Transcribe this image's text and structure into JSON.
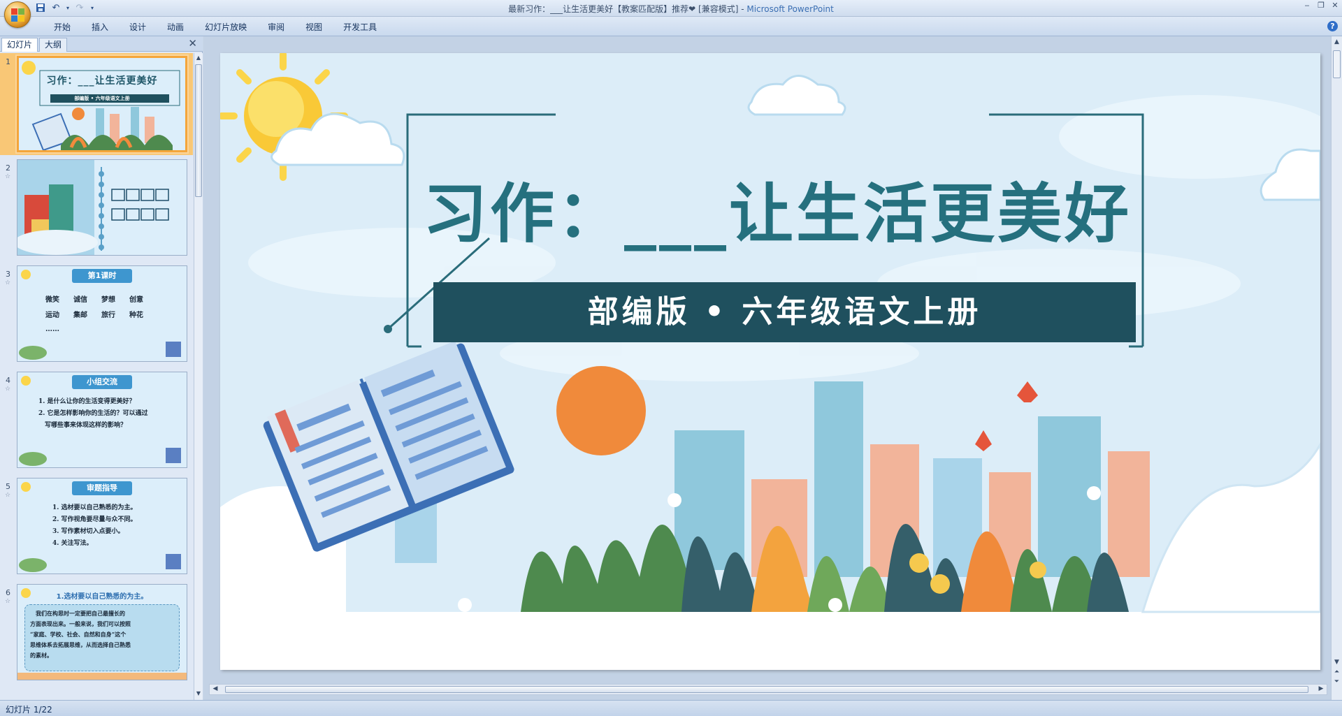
{
  "window": {
    "title_doc": "最新习作：___让生活更美好【教案匹配版】推荐❤ [兼容模式] - ",
    "title_app": "Microsoft PowerPoint"
  },
  "ribbon": {
    "tabs": [
      "开始",
      "插入",
      "设计",
      "动画",
      "幻灯片放映",
      "审阅",
      "视图",
      "开发工具"
    ]
  },
  "panel": {
    "tab_slides": "幻灯片",
    "tab_outline": "大纲",
    "thumbnails": [
      {
        "num": "1",
        "title": "习作：___让生活更美好",
        "subtitle": "部编版 • 六年级语文上册"
      },
      {
        "num": "2",
        "title": "",
        "subtitle": ""
      },
      {
        "num": "3",
        "badge": "第1课时",
        "lines": [
          "微笑　　诚信　　梦想　　创意",
          "运动　　集邮　　旅行　　种花",
          "……"
        ]
      },
      {
        "num": "4",
        "badge": "小组交流",
        "lines": [
          "1. 是什么让你的生活变得更美好？",
          "2. 它是怎样影响你的生活的？可以通过",
          "　写哪些事来体现这样的影响？"
        ]
      },
      {
        "num": "5",
        "badge": "审题指导",
        "lines": [
          "1. 选材要以自己熟悉的为主。",
          "2. 写作视角要尽量与众不同。",
          "3. 写作素材切入点要小。",
          "4. 关注写法。"
        ]
      },
      {
        "num": "6",
        "title": "1.选材要以自己熟悉的为主。",
        "lines": [
          "　我们在构思时一定要把自己最擅长的",
          "方面表现出来。一般来说，我们可以按照",
          "“家庭、学校、社会、自然和自身”这个",
          "思维体系去拓展思维，从而选择自己熟悉",
          "的素材。"
        ]
      }
    ]
  },
  "slide": {
    "title": "习作：___让生活更美好",
    "banner": "部编版 • 六年级语文上册"
  },
  "status": {
    "slide_indicator": "幻灯片 1/22"
  }
}
